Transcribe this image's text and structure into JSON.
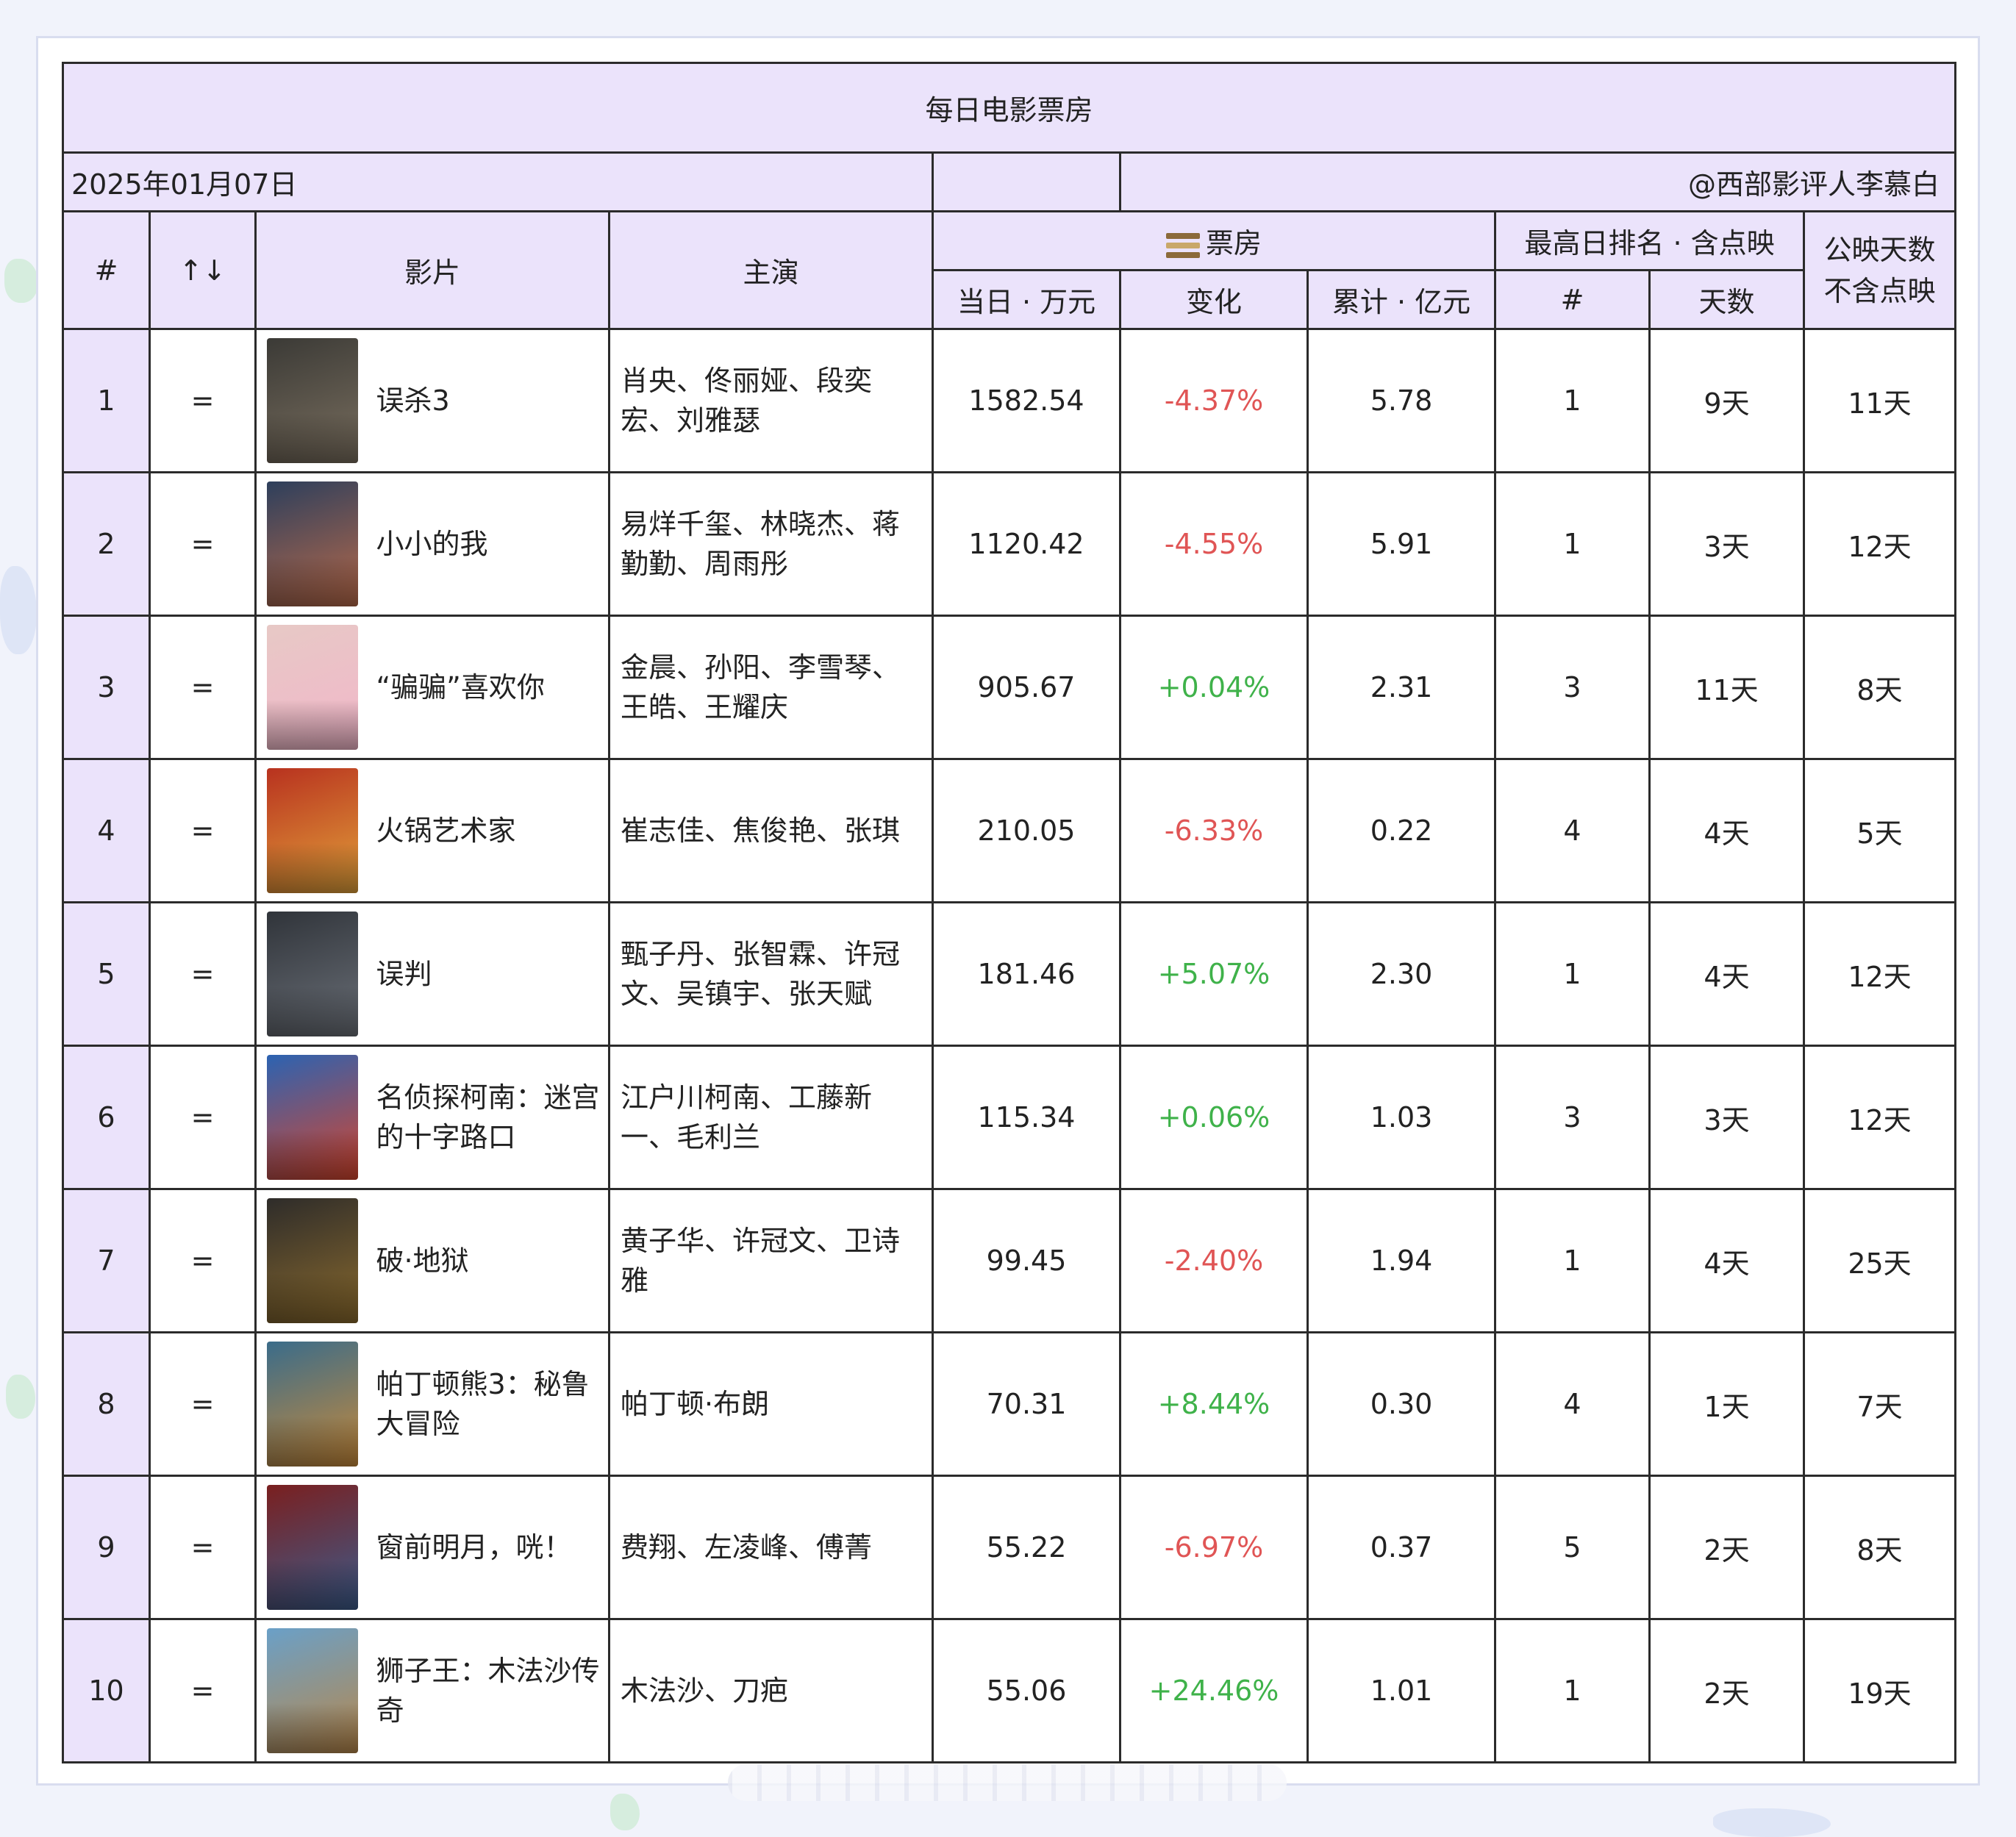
{
  "title": "每日电影票房",
  "date": "2025年01月07日",
  "author": "@西部影评人李慕白",
  "headers": {
    "rank": "#",
    "trend": "↑↓",
    "film": "影片",
    "cast": "主演",
    "boxoffice_group": "票房",
    "boxoffice_group_icon": "film-reel-icon",
    "daily": "当日 · 万元",
    "change": "变化",
    "total": "累计 · 亿元",
    "best_rank_group": "最高日排名 · 含点映",
    "best_rank": "#",
    "best_rank_days": "天数",
    "release_days_line1": "公映天数",
    "release_days_line2": "不含点映"
  },
  "colors": {
    "header_bg": "#ebe3fb",
    "negative": "#e05555",
    "positive": "#3fb24a"
  },
  "rows": [
    {
      "rank": "1",
      "trend": "=",
      "film": "误杀3",
      "cast": "肖央、佟丽娅、段奕宏、刘雅瑟",
      "daily": "1582.54",
      "change": "-4.37%",
      "total": "5.78",
      "best": "1",
      "best_days": "9天",
      "release_days": "11天"
    },
    {
      "rank": "2",
      "trend": "=",
      "film": "小小的我",
      "cast": "易烊千玺、林晓杰、蒋勤勤、周雨彤",
      "daily": "1120.42",
      "change": "-4.55%",
      "total": "5.91",
      "best": "1",
      "best_days": "3天",
      "release_days": "12天"
    },
    {
      "rank": "3",
      "trend": "=",
      "film": "“骗骗”喜欢你",
      "cast": "金晨、孙阳、李雪琴、王皓、王耀庆",
      "daily": "905.67",
      "change": "+0.04%",
      "total": "2.31",
      "best": "3",
      "best_days": "11天",
      "release_days": "8天"
    },
    {
      "rank": "4",
      "trend": "=",
      "film": "火锅艺术家",
      "cast": "崔志佳、焦俊艳、张琪",
      "daily": "210.05",
      "change": "-6.33%",
      "total": "0.22",
      "best": "4",
      "best_days": "4天",
      "release_days": "5天"
    },
    {
      "rank": "5",
      "trend": "=",
      "film": "误判",
      "cast": "甄子丹、张智霖、许冠文、吴镇宇、张天赋",
      "daily": "181.46",
      "change": "+5.07%",
      "total": "2.30",
      "best": "1",
      "best_days": "4天",
      "release_days": "12天"
    },
    {
      "rank": "6",
      "trend": "=",
      "film": "名侦探柯南：迷宫的十字路口",
      "cast": "江户川柯南、工藤新一、毛利兰",
      "daily": "115.34",
      "change": "+0.06%",
      "total": "1.03",
      "best": "3",
      "best_days": "3天",
      "release_days": "12天"
    },
    {
      "rank": "7",
      "trend": "=",
      "film": "破·地狱",
      "cast": "黄子华、许冠文、卫诗雅",
      "daily": "99.45",
      "change": "-2.40%",
      "total": "1.94",
      "best": "1",
      "best_days": "4天",
      "release_days": "25天"
    },
    {
      "rank": "8",
      "trend": "=",
      "film": "帕丁顿熊3：秘鲁大冒险",
      "cast": "帕丁顿·布朗",
      "daily": "70.31",
      "change": "+8.44%",
      "total": "0.30",
      "best": "4",
      "best_days": "1天",
      "release_days": "7天"
    },
    {
      "rank": "9",
      "trend": "=",
      "film": "窗前明月，咣！",
      "cast": "费翔、左凌峰、傅菁",
      "daily": "55.22",
      "change": "-6.97%",
      "total": "0.37",
      "best": "5",
      "best_days": "2天",
      "release_days": "8天"
    },
    {
      "rank": "10",
      "trend": "=",
      "film": "狮子王：木法沙传奇",
      "cast": "木法沙、刀疤",
      "daily": "55.06",
      "change": "+24.46%",
      "total": "1.01",
      "best": "1",
      "best_days": "2天",
      "release_days": "19天"
    }
  ]
}
